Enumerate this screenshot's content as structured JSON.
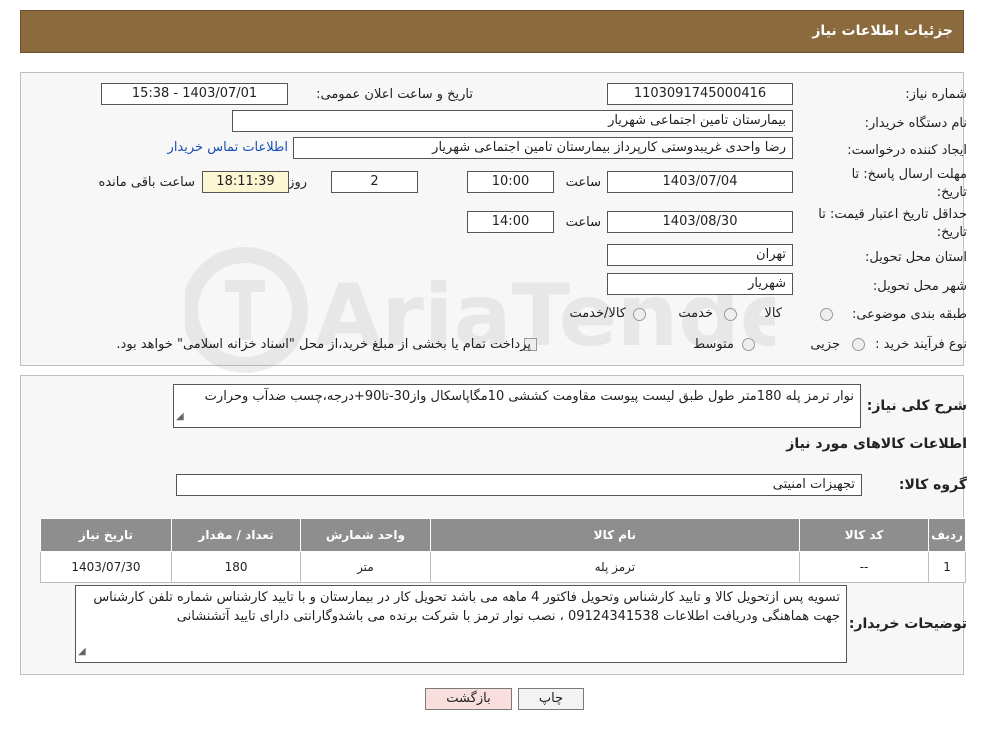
{
  "header": {
    "title": "جزئیات اطلاعات نیاز"
  },
  "form": {
    "need_number_label": "شماره نیاز:",
    "need_number": "1103091745000416",
    "announce_label": "تاریخ و ساعت اعلان عمومی:",
    "announce_value": "1403/07/01 - 15:38",
    "buyer_org_label": "نام دستگاه خریدار:",
    "buyer_org": "بیمارستان تامین اجتماعی شهریار",
    "requester_label": "ایجاد کننده درخواست:",
    "requester": "رضا واحدی غریبدوستی کارپرداز بیمارستان تامین اجتماعی شهریار",
    "contact_link": "اطلاعات تماس خریدار",
    "deadline_label": "مهلت ارسال پاسخ: تا تاریخ:",
    "deadline_date": "1403/07/04",
    "time_label": "ساعت",
    "deadline_time": "10:00",
    "days_value": "2",
    "days_label": "روز و",
    "remaining_time": "18:11:39",
    "remaining_label": "ساعت باقی مانده",
    "validity_label": "حداقل تاریخ اعتبار قیمت: تا تاریخ:",
    "validity_date": "1403/08/30",
    "validity_time": "14:00",
    "province_label": "استان محل تحویل:",
    "province": "تهران",
    "city_label": "شهر محل تحویل:",
    "city": "شهریار",
    "category_label": "طبقه بندی موضوعی:",
    "category_options": [
      "کالا",
      "خدمت",
      "کالا/خدمت"
    ],
    "process_label": "نوع فرآیند خرید :",
    "process_options": [
      "جزیی",
      "متوسط"
    ],
    "process_note": "پرداخت تمام یا بخشی از مبلغ خرید،از محل \"اسناد خزانه اسلامی\" خواهد بود."
  },
  "needs": {
    "summary_label": "شرح کلی نیاز:",
    "summary": "نوار ترمز پله 180متر طول طبق لیست پیوست مقاومت کششی 10مگاپاسکال واز30-تا90+درجه،چسب ضدآب وحرارت",
    "goods_title": "اطلاعات کالاهای مورد نیاز",
    "group_label": "گروه کالا:",
    "group_value": "تجهیزات امنیتی",
    "table": {
      "headers": [
        "ردیف",
        "کد کالا",
        "نام کالا",
        "واحد شمارش",
        "تعداد / مقدار",
        "تاریخ نیاز"
      ],
      "rows": [
        [
          "1",
          "--",
          "ترمز پله",
          "متر",
          "180",
          "1403/07/30"
        ]
      ]
    },
    "buyer_notes_label": "توضیحات خریدار:",
    "buyer_notes": "تسویه پس ازتحویل کالا  و تایید کارشناس وتحویل فاکتور 4 ماهه می باشد تحویل کار در بیمارستان و با تایید کارشناس شماره تلفن کارشناس جهت هماهنگی ودریافت اطلاعات 09124341538 ، نصب نوار ترمز با شرکت برنده می باشدوگارانتی دارای تایید آتشنشانی"
  },
  "buttons": {
    "print": "چاپ",
    "back": "بازگشت"
  },
  "colors": {
    "header_bg": "#8b6a3e",
    "table_header_bg": "#8e8e8e",
    "back_button_bg": "#f9dede",
    "link": "#1a4fb5"
  }
}
